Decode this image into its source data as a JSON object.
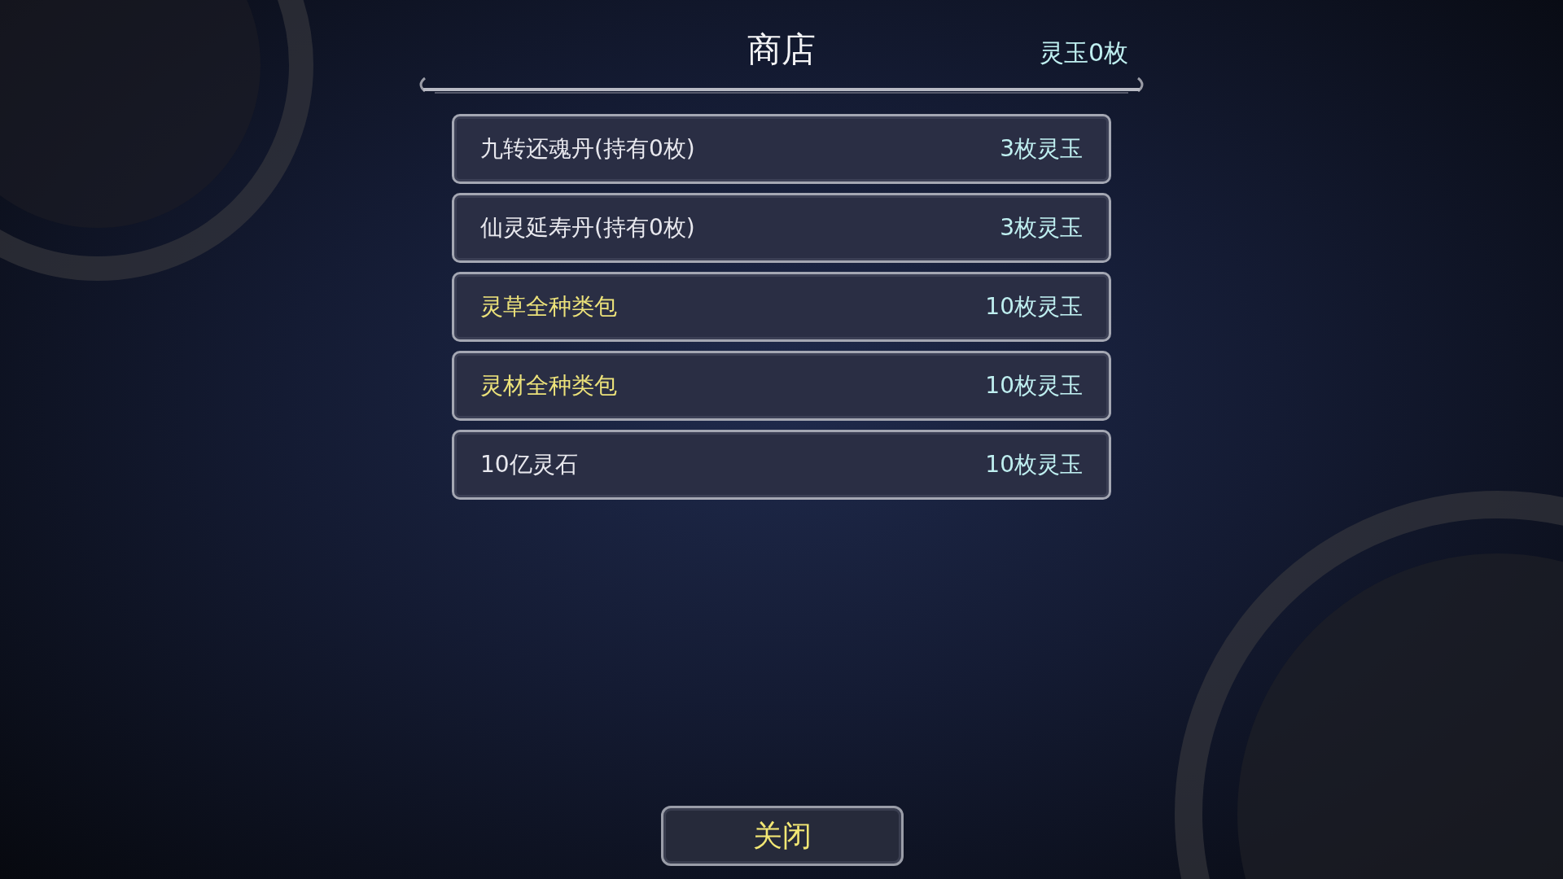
{
  "header": {
    "title": "商店",
    "balance": "灵玉0枚"
  },
  "items": [
    {
      "name": "九转还魂丹(持有0枚)",
      "price": "3枚灵玉",
      "color": "#e8e8ee"
    },
    {
      "name": "仙灵延寿丹(持有0枚)",
      "price": "3枚灵玉",
      "color": "#e8e8ee"
    },
    {
      "name": "灵草全种类包",
      "price": "10枚灵玉",
      "color": "#ece27a"
    },
    {
      "name": "灵材全种类包",
      "price": "10枚灵玉",
      "color": "#ece27a"
    },
    {
      "name": "10亿灵石",
      "price": "10枚灵玉",
      "color": "#e8e8ee"
    }
  ],
  "close_button": "关闭"
}
